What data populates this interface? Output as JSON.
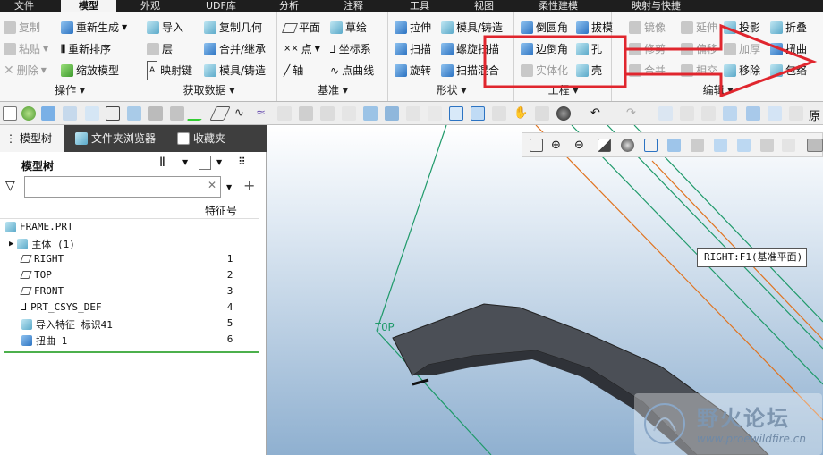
{
  "menubar": {
    "items": [
      "文件",
      "模型",
      "外观",
      "UDF库",
      "分析",
      "注释",
      "工具",
      "视图",
      "柔性建模",
      "映射与快捷"
    ],
    "active_index": 1
  },
  "ribbon": {
    "groups": [
      {
        "label": "操作",
        "items": [
          {
            "label": "复制",
            "disabled": true
          },
          {
            "label": "粘贴",
            "disabled": true
          },
          {
            "label": "删除",
            "disabled": true
          },
          {
            "label": "重新生成",
            "disabled": false
          },
          {
            "label": "重新排序",
            "disabled": false
          },
          {
            "label": "缩放模型",
            "disabled": false
          }
        ]
      },
      {
        "label": "获取数据",
        "items": [
          {
            "label": "导入"
          },
          {
            "label": "层"
          },
          {
            "label": "映射键"
          },
          {
            "label": "复制几何"
          },
          {
            "label": "合并/继承"
          },
          {
            "label": "模具/铸造"
          }
        ]
      },
      {
        "label": "基准",
        "items": [
          {
            "label": "平面"
          },
          {
            "label": "点"
          },
          {
            "label": "轴"
          },
          {
            "label": "草绘"
          },
          {
            "label": "坐标系"
          },
          {
            "label": "点曲线"
          }
        ]
      },
      {
        "label": "形状",
        "items": [
          {
            "label": "拉伸"
          },
          {
            "label": "扫描"
          },
          {
            "label": "旋转"
          },
          {
            "label": "模具/铸造"
          },
          {
            "label": "螺旋扫描"
          },
          {
            "label": "扫描混合"
          }
        ]
      },
      {
        "label": "工程",
        "items": [
          {
            "label": "倒圆角"
          },
          {
            "label": "边倒角"
          },
          {
            "label": "实体化",
            "disabled": true
          },
          {
            "label": "拔模"
          },
          {
            "label": "孔"
          },
          {
            "label": "壳"
          }
        ]
      },
      {
        "label": "编辑",
        "items": [
          {
            "label": "镜像",
            "disabled": true
          },
          {
            "label": "修剪",
            "disabled": true
          },
          {
            "label": "合并",
            "disabled": true
          },
          {
            "label": "延伸",
            "disabled": true
          },
          {
            "label": "偏移",
            "disabled": true
          },
          {
            "label": "相交",
            "disabled": true
          },
          {
            "label": "投影"
          },
          {
            "label": "加厚",
            "disabled": true
          },
          {
            "label": "移除"
          },
          {
            "label": "折叠"
          },
          {
            "label": "扭曲"
          },
          {
            "label": "包络"
          }
        ]
      }
    ]
  },
  "panel": {
    "tabs": [
      "模型树",
      "文件夹浏览器",
      "收藏夹"
    ],
    "tree_title": "模型树",
    "search_value": "",
    "column_header": "特征号",
    "rows": [
      {
        "name": "FRAME.PRT",
        "num": "",
        "icon": "part-icon"
      },
      {
        "name": "主体 (1)",
        "num": "",
        "icon": "body-icon"
      },
      {
        "name": "RIGHT",
        "num": "1",
        "icon": "datum-plane-icon"
      },
      {
        "name": "TOP",
        "num": "2",
        "icon": "datum-plane-icon"
      },
      {
        "name": "FRONT",
        "num": "3",
        "icon": "datum-plane-icon"
      },
      {
        "name": "PRT_CSYS_DEF",
        "num": "4",
        "icon": "csys-icon"
      },
      {
        "name": "导入特征 标识41",
        "num": "5",
        "icon": "import-icon"
      },
      {
        "name": "扭曲 1",
        "num": "6",
        "icon": "warp-icon"
      }
    ]
  },
  "viewport": {
    "tooltip": "RIGHT:F1(基准平面)",
    "plane_label": "TOP",
    "watermark": "野火论坛",
    "watermark_url": "www.proewildfire.cn"
  },
  "colors": {
    "accent": "#2c73c2",
    "annotation_red": "#e0262e",
    "menubar": "#1e1e1e"
  }
}
